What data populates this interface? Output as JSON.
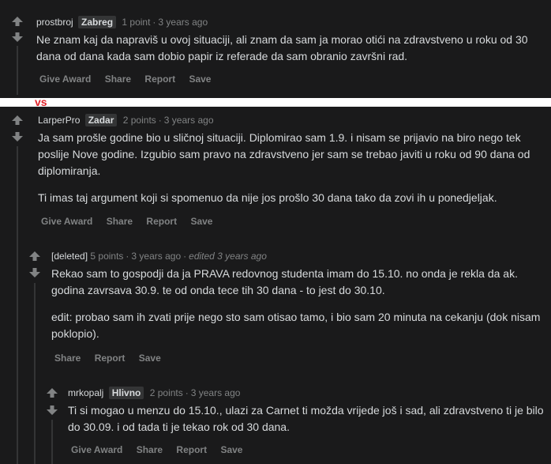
{
  "separator_label": "vs",
  "colors": {
    "background": "#1a1a1b",
    "text": "#d7dadc",
    "muted": "#818384",
    "separator": "#e0242b",
    "flair_bg": "#343536"
  },
  "comments": [
    {
      "author": "prostbroj",
      "flair": "Zabreg",
      "points": "1 point",
      "age": "3 years ago",
      "edited": "",
      "paragraphs": [
        "Ne znam kaj da napraviš u ovoj situaciji, ali znam da sam ja morao otići na zdravstveno u roku od 30 dana od dana kada sam dobio papir iz referade da sam obranio završni rad."
      ],
      "actions": [
        "Give Award",
        "Share",
        "Report",
        "Save"
      ]
    },
    {
      "author": "LarperPro",
      "flair": "Zadar",
      "points": "2 points",
      "age": "3 years ago",
      "edited": "",
      "paragraphs": [
        "Ja sam prošle godine bio u sličnoj situaciji. Diplomirao sam 1.9. i nisam se prijavio na biro nego tek poslije Nove godine. Izgubio sam pravo na zdravstveno jer sam se trebao javiti u roku od 90 dana od diplomiranja.",
        "Ti imas taj argument koji si spomenuo da nije jos prošlo 30 dana tako da zovi ih u ponedjeljak."
      ],
      "actions": [
        "Give Award",
        "Share",
        "Report",
        "Save"
      ]
    },
    {
      "author": "[deleted]",
      "flair": "",
      "points": "5 points",
      "age": "3 years ago",
      "edited": "edited 3 years ago",
      "paragraphs": [
        "Rekao sam to gospodji da ja PRAVA redovnog studenta imam do 15.10. no onda je rekla da ak. godina zavrsava 30.9. te od onda tece tih 30 dana - to jest do 30.10.",
        "edit: probao sam ih zvati prije nego sto sam otisao tamo, i bio sam 20 minuta na cekanju (dok nisam poklopio)."
      ],
      "actions": [
        "Share",
        "Report",
        "Save"
      ]
    },
    {
      "author": "mrkopalj",
      "flair": "Hlivno",
      "points": "2 points",
      "age": "3 years ago",
      "edited": "",
      "paragraphs": [
        "Ti si mogao u menzu do 15.10., ulazi za Carnet ti možda vrijede još i sad, ali zdravstveno ti je bilo do 30.09. i od tada ti je tekao rok od 30 dana."
      ],
      "actions": [
        "Give Award",
        "Share",
        "Report",
        "Save"
      ]
    }
  ]
}
